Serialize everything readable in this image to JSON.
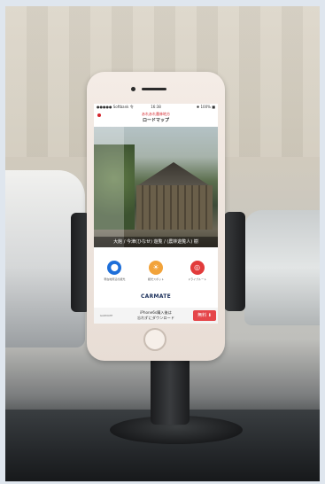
{
  "status_bar": {
    "left": "●●●●● Softbank 令",
    "time": "16:38",
    "right": "✱ 100% ■"
  },
  "app_header": {
    "subtitle": "あれあれ農林地方",
    "title": "ロードマップ"
  },
  "photo": {
    "caption": "大館 / 今津(ひなせ) 遊覧 / (農林遊覧人) 樹"
  },
  "actions": [
    {
      "label": "現在地周辺の観光",
      "color": "#1e6fd9",
      "icon": "location-pin-icon"
    },
    {
      "label": "観光スポット",
      "color": "#f2a33a",
      "icon": "sun-icon"
    },
    {
      "label": "ドライブルート",
      "color": "#e23b3b",
      "icon": "steering-wheel-icon"
    }
  ],
  "brand": {
    "name": "CARMATE"
  },
  "banner": {
    "logo": "GARMATE",
    "line1": "iPhone6s購入後は",
    "line2": "忘れずにダウンロード",
    "button": "無料 ⬇"
  }
}
